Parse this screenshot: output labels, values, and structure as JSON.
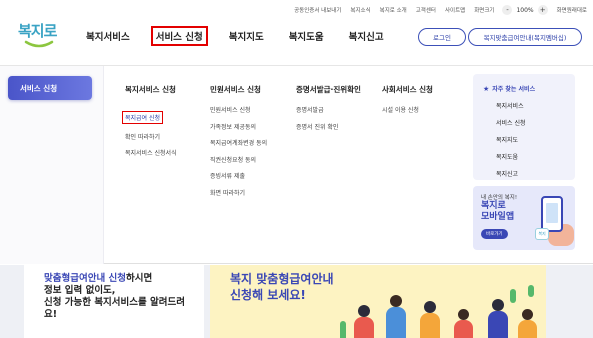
{
  "utility": {
    "links": [
      "공동인증서 내보내기",
      "복지소식",
      "복지로 소개",
      "고객센터",
      "사이트맵",
      "화면크기"
    ],
    "zoom_minus": "-",
    "zoom_value": "100%",
    "zoom_plus": "+",
    "reset": "화면원래대로"
  },
  "logo": {
    "text": "복지로"
  },
  "gnb": [
    "복지서비스",
    "서비스 신청",
    "복지지도",
    "복지도움",
    "복지신고"
  ],
  "header_buttons": {
    "login": "로그인",
    "guide": "복지맞춤급여안내(복지멤버십)"
  },
  "mega": {
    "tab": "서비스 신청",
    "columns": [
      {
        "title": "복지서비스 신청",
        "links": [
          "복지급여 신청",
          "확인 따라하기",
          "복지서비스 신청서식"
        ]
      },
      {
        "title": "민원서비스 신청",
        "links": [
          "민원서비스 신청",
          "가족정보 제공동의",
          "복지급여계좌변경 동의",
          "직권신청요청 동의",
          "증빙서류 제출",
          "화면 따라하기"
        ]
      },
      {
        "title": "증명서발급·진위확인",
        "links": [
          "증명서발급",
          "증명서 진위 확인"
        ]
      },
      {
        "title": "사회서비스 신청",
        "links": [
          "시설 이용 신청"
        ]
      }
    ],
    "frequent": {
      "title": "자주 찾는 서비스",
      "links": [
        "복지서비스",
        "서비스 신청",
        "복지지도",
        "복지도움",
        "복지신고"
      ]
    },
    "app_banner": {
      "sub": "내 손안의 복지!",
      "title_line1": "복지로",
      "title_line2": "모바일앱",
      "button": "바로가기",
      "logo": "복지"
    }
  },
  "hero": {
    "left_line1_blue": "맞춤형급여안내 신청",
    "left_line1_rest": "하시면",
    "left_line2": "정보 입력 없이도,",
    "left_line3": "신청 가능한 복지서비스를 알려드려",
    "left_line4": "요!",
    "right_line1": "복지 맞춤형급여안내",
    "right_line2": "신청해 보세요!"
  },
  "colors": {
    "accent": "#3a47b5",
    "highlight_box": "#e30000",
    "logo": "#3aa3c4"
  }
}
